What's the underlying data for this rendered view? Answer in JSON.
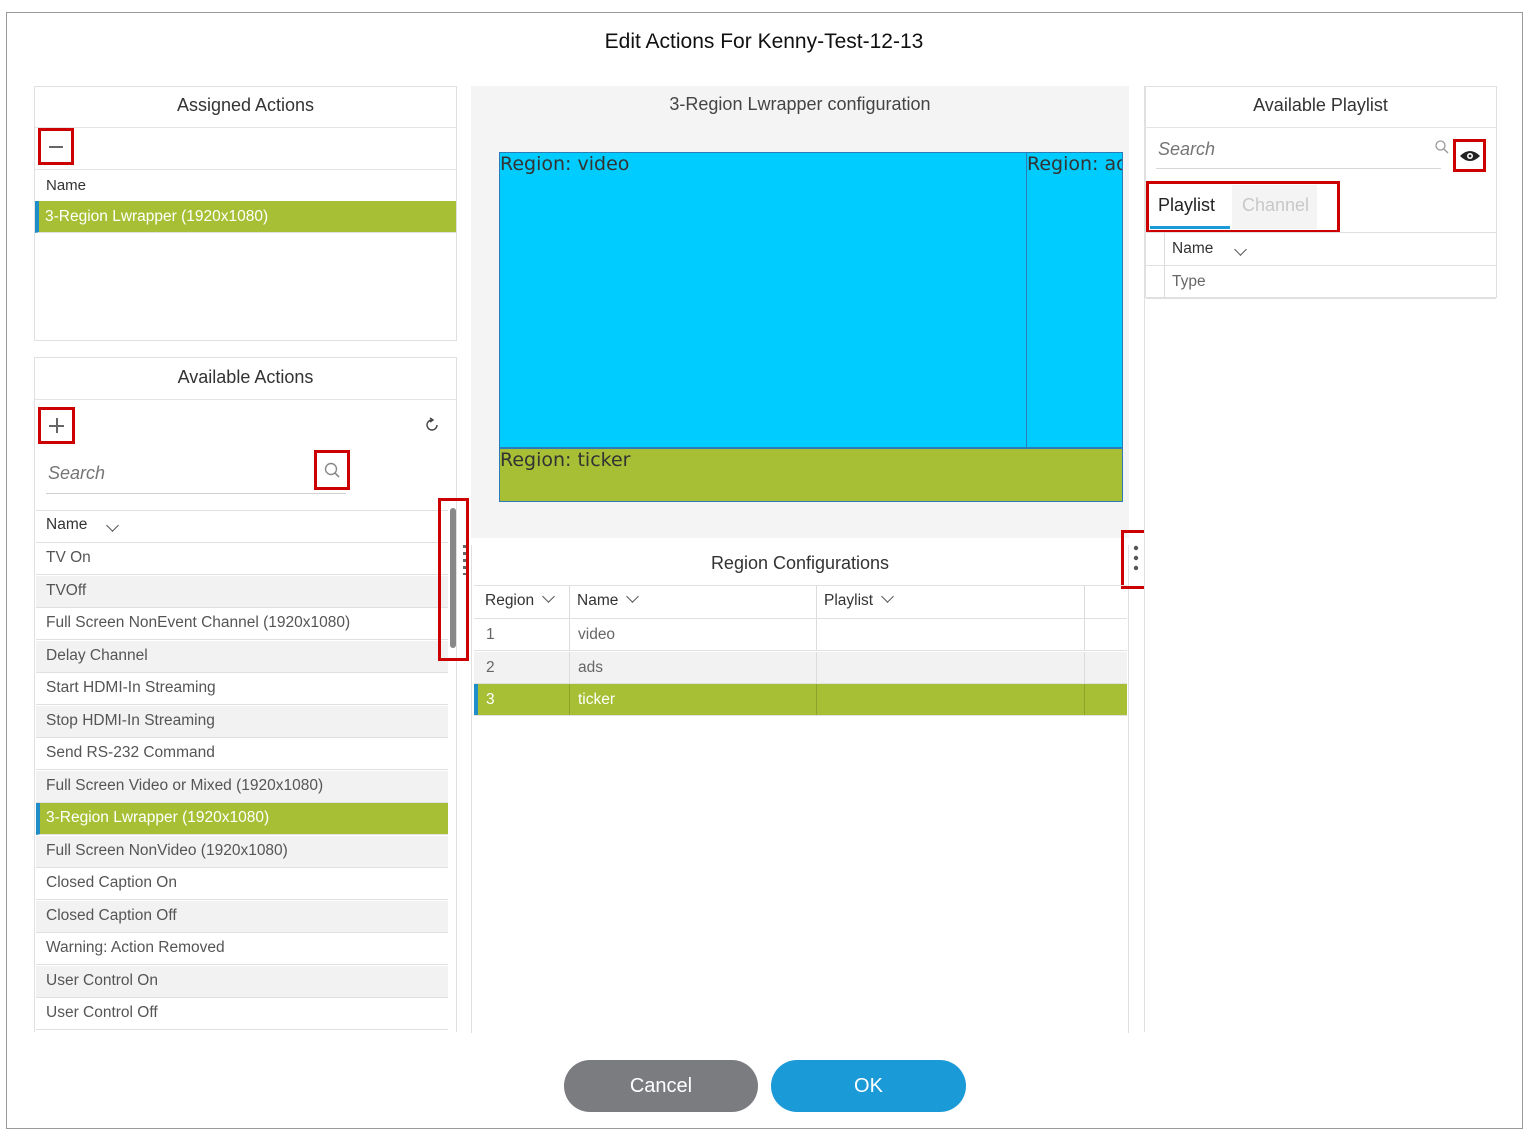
{
  "dialog": {
    "title": "Edit Actions For Kenny-Test-12-13"
  },
  "assigned": {
    "title": "Assigned Actions",
    "column_name": "Name",
    "items": [
      "3-Region Lwrapper (1920x1080)"
    ]
  },
  "available": {
    "title": "Available Actions",
    "search_placeholder": "Search",
    "column_name": "Name",
    "items": [
      "TV On",
      "TVOff",
      "Full Screen NonEvent Channel (1920x1080)",
      "Delay Channel",
      "Start HDMI-In Streaming",
      "Stop HDMI-In Streaming",
      "Send RS-232 Command",
      "Full Screen Video or Mixed (1920x1080)",
      "3-Region Lwrapper (1920x1080)",
      "Full Screen NonVideo (1920x1080)",
      "Closed Caption On",
      "Closed Caption Off",
      "Warning: Action Removed",
      "User Control On",
      "User Control Off"
    ],
    "selected_index": 8
  },
  "config": {
    "title": "3-Region Lwrapper configuration",
    "regions": {
      "video": "Region: video",
      "ads": "Region: ads",
      "ticker": "Region: ticker"
    },
    "colors": {
      "video": "#00ccff",
      "ads": "#00ccff",
      "ticker": "#a6bf34"
    }
  },
  "region_config": {
    "title": "Region Configurations",
    "columns": [
      "Region",
      "Name",
      "Playlist"
    ],
    "rows": [
      {
        "region": "1",
        "name": "video",
        "playlist": ""
      },
      {
        "region": "2",
        "name": "ads",
        "playlist": ""
      },
      {
        "region": "3",
        "name": "ticker",
        "playlist": ""
      }
    ],
    "selected_index": 2
  },
  "playlist": {
    "title": "Available Playlist",
    "search_placeholder": "Search",
    "tabs": [
      "Playlist",
      "Channel"
    ],
    "active_tab": "Playlist",
    "columns": [
      "Name",
      "Type"
    ]
  },
  "buttons": {
    "cancel": "Cancel",
    "ok": "OK"
  },
  "theme": {
    "accent_green": "#a6bf34",
    "accent_blue": "#1a9ad6",
    "cancel_gray": "#7b7c80",
    "highlight_red": "#cc0000"
  }
}
